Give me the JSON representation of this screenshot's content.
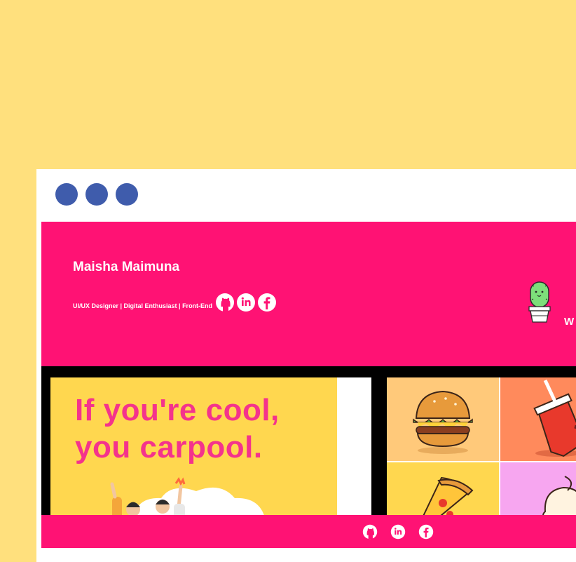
{
  "window": {
    "controls": [
      {
        "name": "window-dot-1",
        "color": "#3f5cac"
      },
      {
        "name": "window-dot-2",
        "color": "#3f5cac"
      },
      {
        "name": "window-dot-3",
        "color": "#3f5cac"
      }
    ]
  },
  "header": {
    "name": "Maisha Maimuna",
    "tagline": "UI/UX Designer | Digital Enthusiast | Front-End",
    "social_icons": [
      "github-icon",
      "linkedin-icon",
      "facebook-icon"
    ],
    "welcome_partial": "W",
    "mascot_icon": "cactus-icon"
  },
  "gallery": {
    "poster": {
      "line1": "If you're cool,",
      "line2": "you carpool."
    },
    "food_tiles": [
      "burger-icon",
      "soda-cup-icon",
      "pizza-slice-icon",
      "ice-cream-icon"
    ]
  },
  "footer": {
    "social_icons": [
      "github-icon",
      "linkedin-icon",
      "facebook-icon"
    ]
  },
  "colors": {
    "page_background": "#ffe07d",
    "brand_pink": "#ff1274",
    "window_dot": "#3f5cac",
    "poster_yellow": "#ffd74f",
    "poster_text": "#f4338c"
  }
}
